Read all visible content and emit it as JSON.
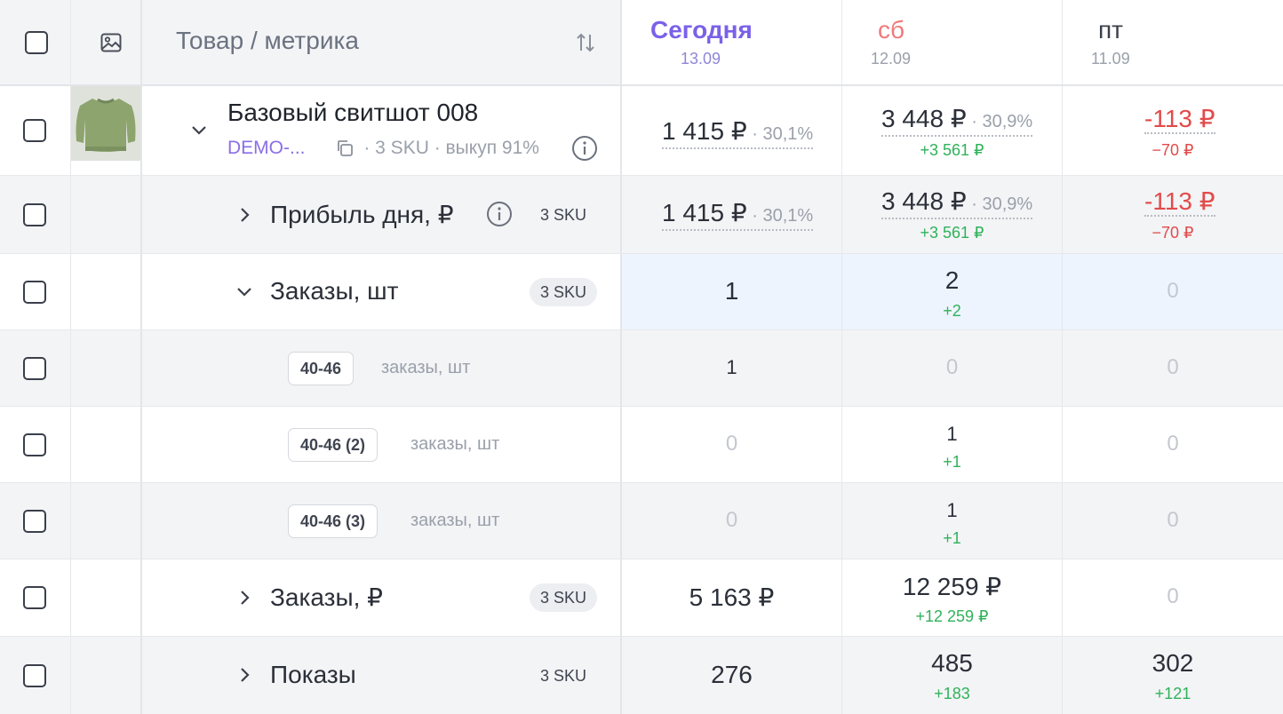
{
  "header": {
    "title": "Товар / метрика",
    "days": [
      {
        "name": "Сегодня",
        "date": "13.09"
      },
      {
        "name": "сб",
        "date": "12.09"
      },
      {
        "name": "пт",
        "date": "11.09"
      }
    ]
  },
  "product": {
    "title": "Базовый свитшот 008",
    "code": "DEMO-...",
    "meta": "· 3 SKU · выкуп 91%",
    "values": [
      {
        "value": "1 415 ₽",
        "pct": " · 30,1%",
        "delta": ""
      },
      {
        "value": "3 448 ₽",
        "pct": " · 30,9%",
        "delta": "+3 561 ₽"
      },
      {
        "value": "-113 ₽",
        "pct": "",
        "delta": "−70 ₽"
      }
    ]
  },
  "rows": [
    {
      "label": "Прибыль дня, ₽",
      "sku": "3 SKU",
      "values": [
        {
          "value": "1 415 ₽",
          "pct": " · 30,1%",
          "delta": ""
        },
        {
          "value": "3 448 ₽",
          "pct": " · 30,9%",
          "delta": "+3 561 ₽"
        },
        {
          "value": "-113 ₽",
          "pct": "",
          "delta": "−70 ₽"
        }
      ]
    },
    {
      "label": "Заказы, шт",
      "sku": "3 SKU",
      "values": [
        {
          "value": "1",
          "delta": ""
        },
        {
          "value": "2",
          "delta": "+2"
        },
        {
          "value": "0",
          "delta": ""
        }
      ]
    },
    {
      "size": "40-46",
      "label": "заказы, шт",
      "values": [
        {
          "value": "1",
          "delta": ""
        },
        {
          "value": "0",
          "delta": ""
        },
        {
          "value": "0",
          "delta": ""
        }
      ]
    },
    {
      "size": "40-46 (2)",
      "label": "заказы, шт",
      "values": [
        {
          "value": "0",
          "delta": ""
        },
        {
          "value": "1",
          "delta": "+1"
        },
        {
          "value": "0",
          "delta": ""
        }
      ]
    },
    {
      "size": "40-46 (3)",
      "label": "заказы, шт",
      "values": [
        {
          "value": "0",
          "delta": ""
        },
        {
          "value": "1",
          "delta": "+1"
        },
        {
          "value": "0",
          "delta": ""
        }
      ]
    },
    {
      "label": "Заказы, ₽",
      "sku": "3 SKU",
      "values": [
        {
          "value": "5 163 ₽",
          "delta": ""
        },
        {
          "value": "12 259 ₽",
          "delta": "+12 259 ₽"
        },
        {
          "value": "0",
          "delta": ""
        }
      ]
    },
    {
      "label": "Показы",
      "sku": "3 SKU",
      "values": [
        {
          "value": "276",
          "delta": ""
        },
        {
          "value": "485",
          "delta": "+183"
        },
        {
          "value": "302",
          "delta": "+121"
        }
      ]
    }
  ],
  "colors": {
    "accent": "#7b61e8",
    "saturday": "#f07a7a",
    "positive": "#2fb25a",
    "negative": "#e24b4b"
  }
}
